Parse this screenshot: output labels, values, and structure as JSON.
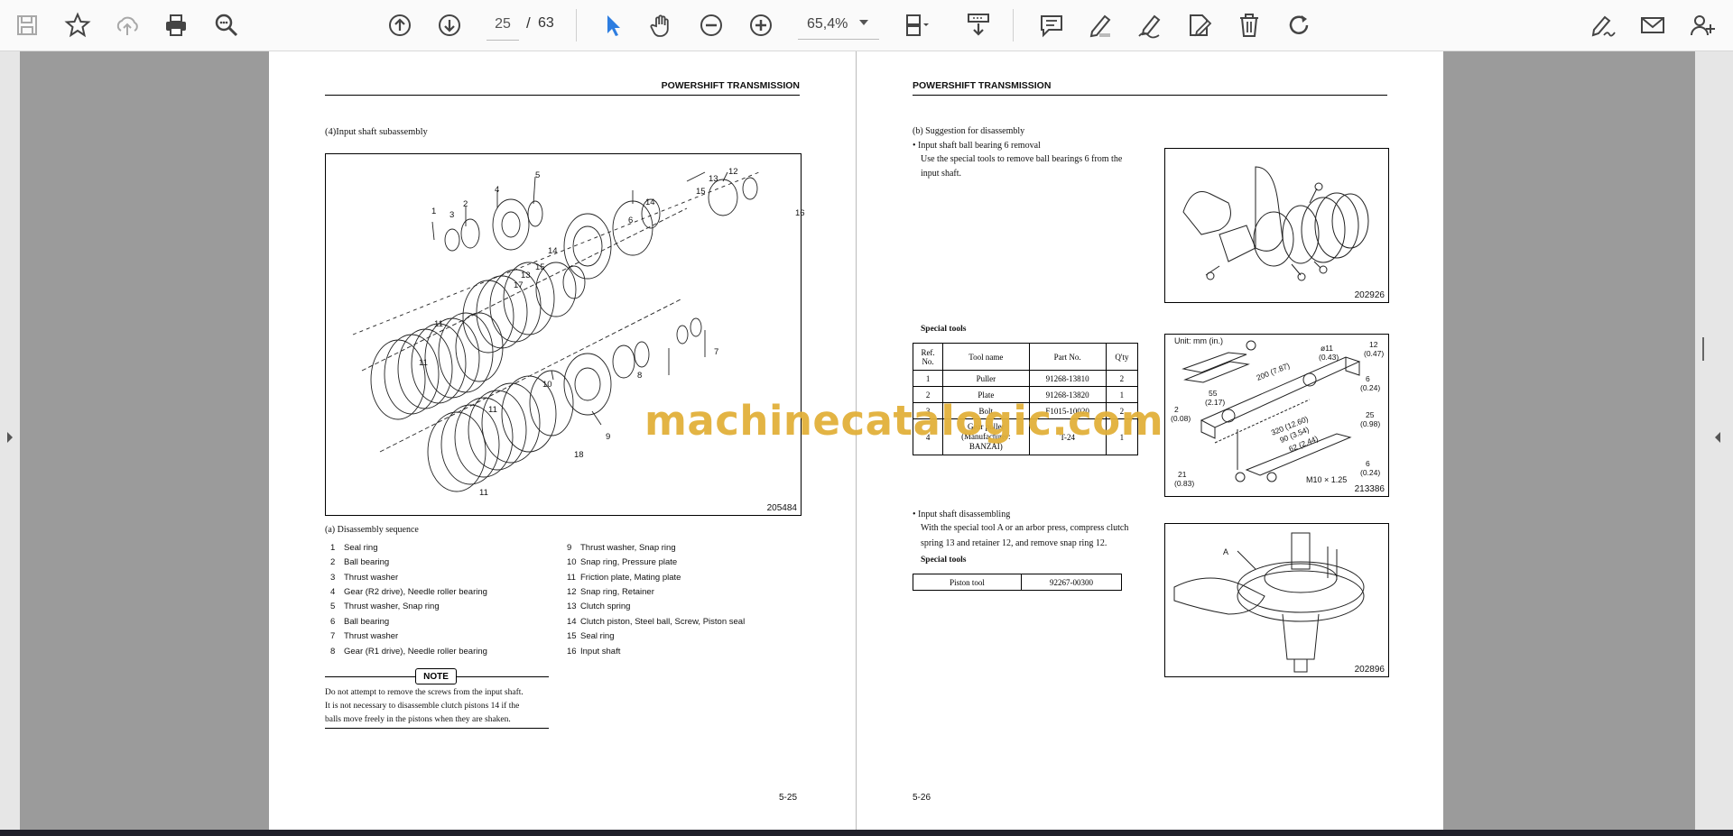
{
  "toolbar": {
    "page_current": "25",
    "page_separator": "/",
    "page_total": "63",
    "zoom_value": "65,4%"
  },
  "left_page": {
    "header": "POWERSHIFT TRANSMISSION",
    "section_title": "(4)Input shaft subassembly",
    "figure_number": "205484",
    "callouts": [
      "1",
      "2",
      "3",
      "4",
      "5",
      "6",
      "7",
      "8",
      "9",
      "10",
      "11",
      "11",
      "11",
      "11",
      "12",
      "13",
      "13",
      "14",
      "14",
      "15",
      "15",
      "16",
      "17",
      "18"
    ],
    "sequence_title": "(a)  Disassembly sequence",
    "sequence": [
      {
        "num": "1",
        "text": "Seal ring"
      },
      {
        "num": "2",
        "text": "Ball bearing"
      },
      {
        "num": "3",
        "text": "Thrust washer"
      },
      {
        "num": "4",
        "text": "Gear (R2 drive), Needle roller bearing"
      },
      {
        "num": "5",
        "text": "Thrust washer, Snap ring"
      },
      {
        "num": "6",
        "text": "Ball bearing"
      },
      {
        "num": "7",
        "text": "Thrust washer"
      },
      {
        "num": "8",
        "text": "Gear (R1 drive), Needle roller bearing"
      },
      {
        "num": "9",
        "text": "Thrust washer, Snap ring"
      },
      {
        "num": "10",
        "text": "Snap ring, Pressure plate"
      },
      {
        "num": "11",
        "text": "Friction plate, Mating plate"
      },
      {
        "num": "12",
        "text": "Snap ring, Retainer"
      },
      {
        "num": "13",
        "text": "Clutch spring"
      },
      {
        "num": "14",
        "text": "Clutch piston, Steel ball, Screw, Piston seal"
      },
      {
        "num": "15",
        "text": "Seal ring"
      },
      {
        "num": "16",
        "text": "Input shaft"
      }
    ],
    "note_label": "NOTE",
    "note_lines": [
      "Do not attempt to remove the screws from the input shaft.",
      "It is not necessary to disassemble clutch pistons 14 if the",
      "balls move freely in the pistons when they are shaken."
    ],
    "page_number": "5-25"
  },
  "right_page": {
    "header": "POWERSHIFT TRANSMISSION",
    "subsection": "(b)  Suggestion for disassembly",
    "bullet1_title": "•  Input shaft ball bearing 6 removal",
    "bullet1_lines": [
      "Use the special tools to remove ball bearings 6 from the",
      "input shaft."
    ],
    "fig1_number": "202926",
    "special_tools_label": "Special tools",
    "table_headers": [
      "Ref.\nNo.",
      "Tool name",
      "Part No.",
      "Q'ty"
    ],
    "table_rows": [
      [
        "1",
        "Puller",
        "91268-13810",
        "2"
      ],
      [
        "2",
        "Plate",
        "91268-13820",
        "1"
      ],
      [
        "3",
        "Bolt",
        "F1015-10020",
        "2"
      ],
      [
        "4",
        "Gear puller\n(Manufacturer:\nBANZAI)",
        "T-24",
        "1"
      ]
    ],
    "fig2_unit": "Unit: mm (in.)",
    "fig2_dims": [
      "ø11",
      "(0.43)",
      "12",
      "(0.47)",
      "200 (7.87)",
      "55",
      "(2.17)",
      "6",
      "(0.24)",
      "2",
      "(0.08)",
      "25",
      "(0.98)",
      "320 (12.60)",
      "90 (3.54)",
      "62 (2.44)",
      "6",
      "(0.24)",
      "21",
      "(0.83)",
      "M10 × 1.25"
    ],
    "fig2_number": "213386",
    "bullet2_title": "•  Input shaft disassembling",
    "bullet2_lines": [
      "With the special tool A or an arbor press, compress clutch",
      "spring 13 and retainer 12, and remove snap ring 12."
    ],
    "special_tools_label2": "Special tools",
    "piston_tool_name": "Piston tool",
    "piston_tool_part": "92267-00300",
    "fig3_label_a": "A",
    "fig3_number": "202896",
    "page_number": "5-26"
  },
  "watermark": "machinecatalogic.com",
  "colors": {
    "toolbar_bg": "#fafafa",
    "viewer_bg": "#9b9b9b",
    "select_icon": "#2d7de0",
    "watermark": "#e2b13b"
  },
  "icons": [
    "save-icon",
    "bookmark-star-icon",
    "cloud-upload-icon",
    "print-icon",
    "zoom-search-icon",
    "page-up-icon",
    "page-down-icon",
    "select-cursor-icon",
    "hand-icon",
    "zoom-out-icon",
    "zoom-in-icon",
    "fit-page-icon",
    "scroll-mode-icon",
    "comment-icon",
    "highlight-icon",
    "draw-icon",
    "edit-text-icon",
    "delete-icon",
    "rotate-icon",
    "sign-icon",
    "mail-icon",
    "add-user-icon"
  ]
}
